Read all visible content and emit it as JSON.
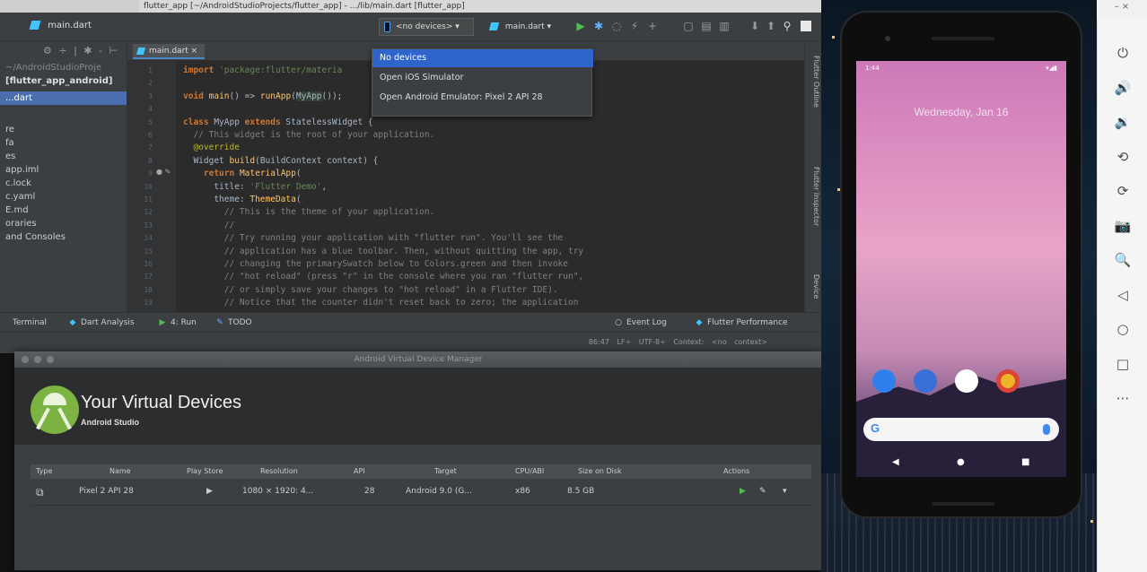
{
  "window": {
    "caption": "flutter_app [~/AndroidStudioProjects/flutter_app] - .../lib/main.dart [flutter_app]"
  },
  "ide": {
    "breadcrumb": "main.dart",
    "device_selector": "<no devices>",
    "run_config": "main.dart",
    "device_dropdown": {
      "items": [
        "No devices",
        "Open iOS Simulator",
        "Open Android Emulator: Pixel 2 API 28"
      ],
      "active_index": 0
    },
    "editor_tab": "main.dart",
    "project_items": [
      {
        "label": "~/AndroidStudioProje",
        "style": "dim"
      },
      {
        "label": "[flutter_app_android]",
        "style": "bold"
      },
      {
        "label": "...dart",
        "style": "sel"
      },
      {
        "label": "re",
        "style": ""
      },
      {
        "label": "fa",
        "style": ""
      },
      {
        "label": "es",
        "style": ""
      },
      {
        "label": "app.iml",
        "style": ""
      },
      {
        "label": "c.lock",
        "style": ""
      },
      {
        "label": "c.yaml",
        "style": ""
      },
      {
        "label": "E.md",
        "style": ""
      },
      {
        "label": "oraries",
        "style": ""
      },
      {
        "label": "and Consoles",
        "style": ""
      }
    ],
    "code_lines": [
      {
        "n": "1",
        "html": "<span class=\"kw\">import</span> <span class=\"str\">'package:flutter/materia</span>"
      },
      {
        "n": "2",
        "html": ""
      },
      {
        "n": "3",
        "html": "<span class=\"kw\">void</span> <span class=\"cls\">main</span>() => <span class=\"cls\">runApp</span>(<span class=\"hl\">MyApp</span>());"
      },
      {
        "n": "4",
        "html": ""
      },
      {
        "n": "5",
        "html": "<span class=\"kw\">class</span> MyApp <span class=\"kw\">extends</span> StatelessWidget {"
      },
      {
        "n": "6",
        "html": "  <span class=\"cm\">// This widget is the root of your application.</span>"
      },
      {
        "n": "7",
        "html": "  <span class=\"ann\">@override</span>"
      },
      {
        "n": "8",
        "html": "  Widget <span class=\"cls\">build</span>(BuildContext context) {"
      },
      {
        "n": "9",
        "html": "    <span class=\"kw\">return</span> <span class=\"cls\">MaterialApp</span>("
      },
      {
        "n": "10",
        "html": "      title: <span class=\"str\">'Flutter Demo'</span>,"
      },
      {
        "n": "11",
        "html": "      theme: <span class=\"cls\">ThemeData</span>("
      },
      {
        "n": "12",
        "html": "        <span class=\"cm\">// This is the theme of your application.</span>"
      },
      {
        "n": "13",
        "html": "        <span class=\"cm\">//</span>"
      },
      {
        "n": "14",
        "html": "        <span class=\"cm\">// Try running your application with \"flutter run\". You'll see the</span>"
      },
      {
        "n": "15",
        "html": "        <span class=\"cm\">// application has a blue toolbar. Then, without quitting the app, try</span>"
      },
      {
        "n": "16",
        "html": "        <span class=\"cm\">// changing the primarySwatch below to Colors.green and then invoke</span>"
      },
      {
        "n": "17",
        "html": "        <span class=\"cm\">// \"hot reload\" (press \"r\" in the console where you ran \"flutter run\",</span>"
      },
      {
        "n": "18",
        "html": "        <span class=\"cm\">// or simply save your changes to \"hot reload\" in a Flutter IDE).</span>"
      },
      {
        "n": "19",
        "html": "        <span class=\"cm\">// Notice that the counter didn't reset back to zero; the application</span>"
      }
    ],
    "right_tabs": [
      "Flutter Outline",
      "Flutter Inspector",
      "Device"
    ],
    "tool_windows": [
      "Terminal",
      "Dart Analysis",
      "4: Run",
      "TODO"
    ],
    "event_log": "Event Log",
    "flutter_performance": "Flutter Performance",
    "status": "86:47  LF÷  UTF-8÷  Context: <no context>"
  },
  "avd": {
    "window_title": "Android Virtual Device Manager",
    "title": "Your Virtual Devices",
    "subtitle": "Android Studio",
    "columns": [
      "Type",
      "Name",
      "Play Store",
      "Resolution",
      "API",
      "Target",
      "CPU/ABI",
      "Size on Disk",
      "Actions"
    ],
    "rows": [
      {
        "name": "Pixel 2 API 28",
        "resolution": "1080 × 1920: 4...",
        "api": "28",
        "target": "Android 9.0 (G...",
        "cpu": "x86",
        "size": "8.5 GB"
      }
    ]
  },
  "emulator": {
    "time": "1:44",
    "date": "Wednesday, Jan 16",
    "google_letter": "G",
    "side_toolbar": [
      "power-icon",
      "volume-up-icon",
      "volume-down-icon",
      "rotate-left-icon",
      "rotate-right-icon",
      "camera-icon",
      "zoom-icon",
      "back-icon",
      "home-icon",
      "overview-icon",
      "more-icon"
    ],
    "side_glyphs": [
      "⏻",
      "🔊",
      "🔉",
      "⟲",
      "⟳",
      "📷",
      "🔍",
      "◁",
      "○",
      "□",
      "⋯"
    ]
  },
  "colors": {
    "accent": "#2f65ca",
    "run_green": "#4fc14f",
    "dart": "#40c4ff",
    "android_green": "#7cb342"
  }
}
